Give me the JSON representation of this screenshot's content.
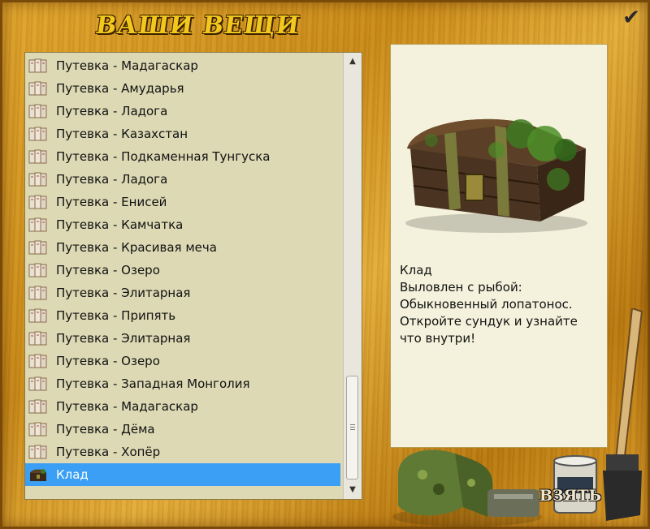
{
  "header": {
    "title": "ВАШИ ВЕЩИ",
    "confirm_icon": "checkmark-icon"
  },
  "list": {
    "items": [
      {
        "label": "Путевка - Мадагаскар",
        "icon": "voucher-icon"
      },
      {
        "label": "Путевка - Амударья",
        "icon": "voucher-icon"
      },
      {
        "label": "Путевка - Ладога",
        "icon": "voucher-icon"
      },
      {
        "label": "Путевка - Казахстан",
        "icon": "voucher-icon"
      },
      {
        "label": "Путевка - Подкаменная Тунгуска",
        "icon": "voucher-icon"
      },
      {
        "label": "Путевка - Ладога",
        "icon": "voucher-icon"
      },
      {
        "label": "Путевка - Енисей",
        "icon": "voucher-icon"
      },
      {
        "label": "Путевка - Камчатка",
        "icon": "voucher-icon"
      },
      {
        "label": "Путевка - Красивая меча",
        "icon": "voucher-icon"
      },
      {
        "label": "Путевка - Озеро",
        "icon": "voucher-icon"
      },
      {
        "label": "Путевка - Элитарная",
        "icon": "voucher-icon"
      },
      {
        "label": "Путевка - Припять",
        "icon": "voucher-icon"
      },
      {
        "label": "Путевка - Элитарная",
        "icon": "voucher-icon"
      },
      {
        "label": "Путевка - Озеро",
        "icon": "voucher-icon"
      },
      {
        "label": "Путевка - Западная Монголия",
        "icon": "voucher-icon"
      },
      {
        "label": "Путевка - Мадагаскар",
        "icon": "voucher-icon"
      },
      {
        "label": "Путевка - Дёма",
        "icon": "voucher-icon"
      },
      {
        "label": "Путевка - Хопёр",
        "icon": "voucher-icon"
      },
      {
        "label": "Клад",
        "icon": "chest-icon",
        "selected": true
      }
    ],
    "selection_color": "#3a9ff5"
  },
  "detail": {
    "image": "treasure-chest-image",
    "lines": [
      "Клад",
      "Выловлен с рыбой:",
      "Обыкновенный лопатонос.",
      "Откройте сундук и узнайте",
      "что внутри!"
    ]
  },
  "actions": {
    "take_label": "ВЗЯТЬ"
  }
}
